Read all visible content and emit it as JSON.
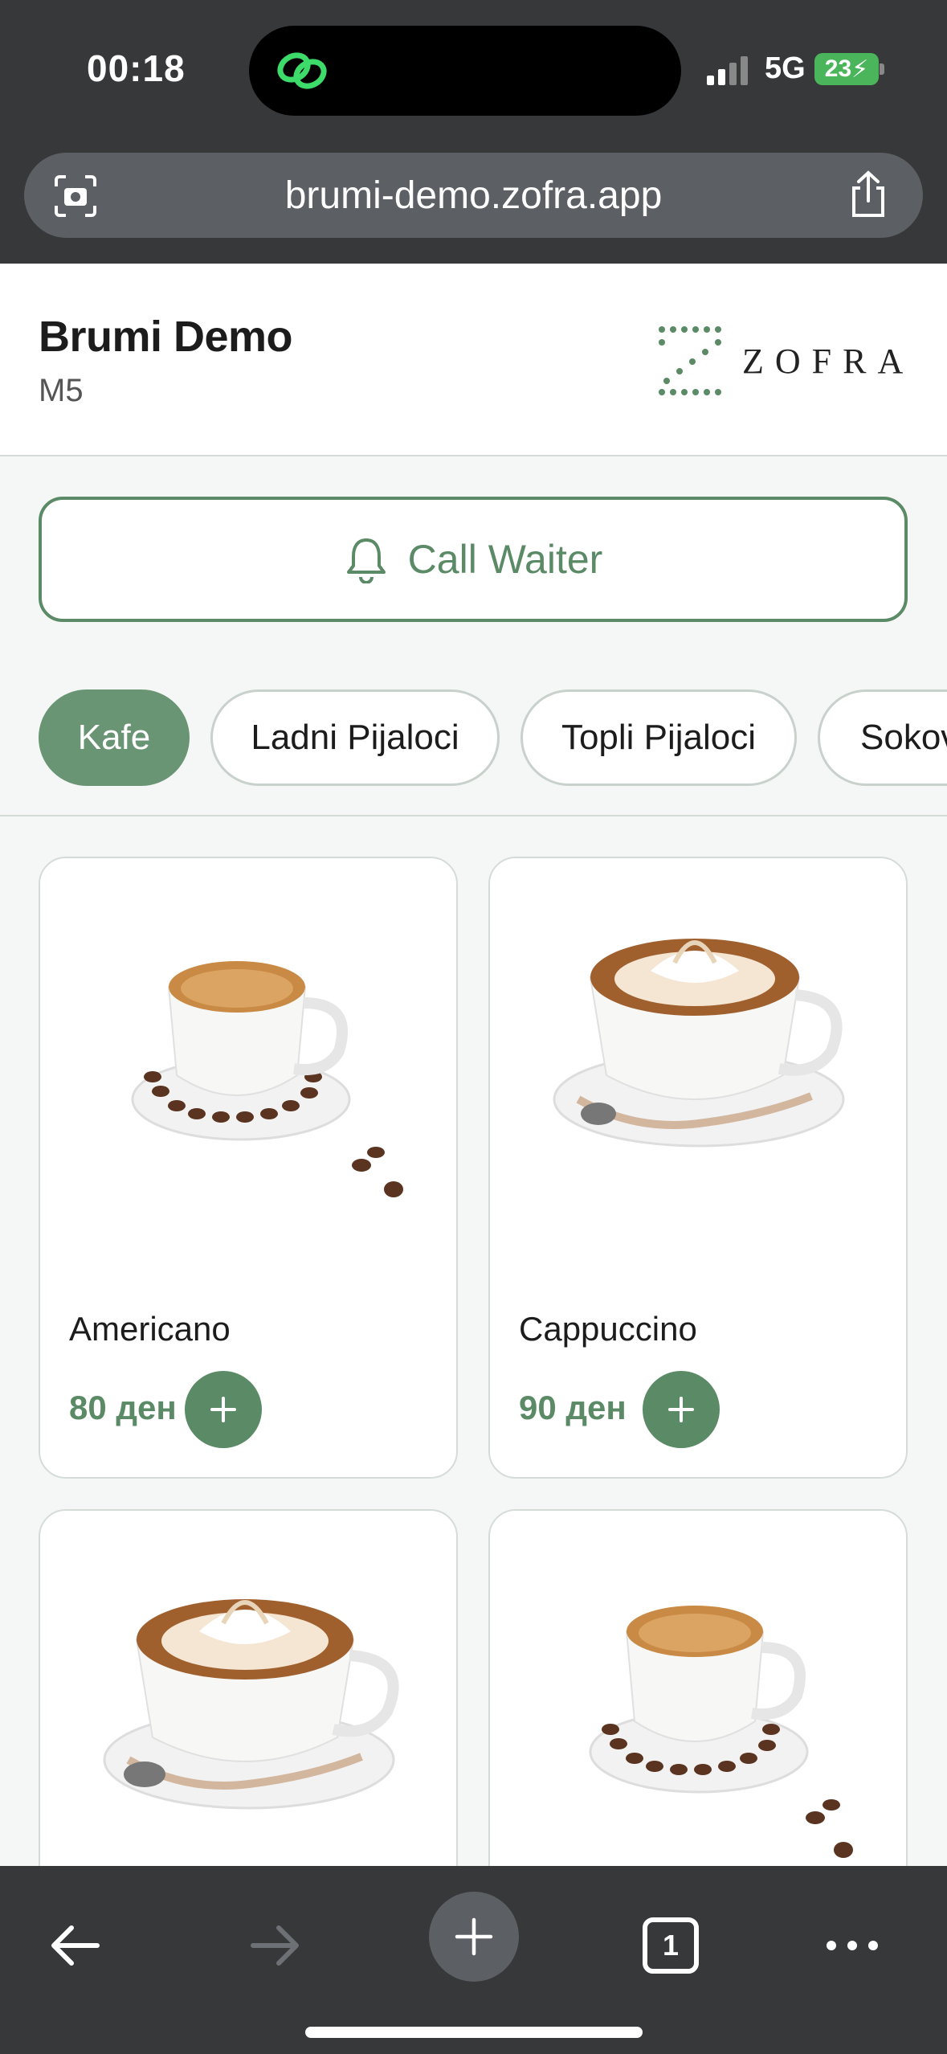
{
  "status_bar": {
    "time": "00:18",
    "network": "5G",
    "battery": "23"
  },
  "browser": {
    "url": "brumi-demo.zofra.app"
  },
  "header": {
    "title": "Brumi Demo",
    "subtitle": "M5",
    "logo_text": "ZOFRA"
  },
  "call_waiter": {
    "label": "Call Waiter"
  },
  "categories": [
    {
      "label": "Kafe",
      "active": true
    },
    {
      "label": "Ladni Pijaloci",
      "active": false
    },
    {
      "label": "Topli Pijaloci",
      "active": false
    },
    {
      "label": "Sokovi",
      "active": false
    }
  ],
  "products": [
    {
      "name": "Americano",
      "price": "80 ден",
      "image": "espresso-cup-with-beans"
    },
    {
      "name": "Cappuccino",
      "price": "90 ден",
      "image": "cappuccino-cup-with-foam"
    },
    {
      "name": "",
      "price": "",
      "image": "cappuccino-cup-with-foam"
    },
    {
      "name": "",
      "price": "",
      "image": "espresso-cup-with-beans"
    }
  ],
  "toolbar": {
    "tab_count": "1"
  },
  "colors": {
    "accent": "#5b8a66",
    "chrome": "#36383a",
    "battery": "#4ab55a"
  }
}
